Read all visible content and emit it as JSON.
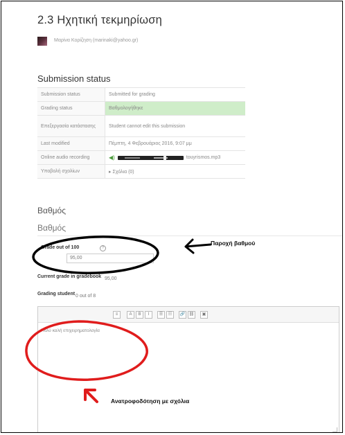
{
  "page": {
    "title": "2.3 Ηχητική τεκμηρίωση"
  },
  "author": {
    "line": "Μαρίνα Κορίζηση (marinaki@yahoo.gr)"
  },
  "submission": {
    "heading": "Submission status",
    "rows": [
      {
        "key": "Submission status",
        "value": "Submitted for grading"
      },
      {
        "key": "Grading status",
        "value": "Βαθμολογήθηκε"
      },
      {
        "key": "Επεξεργασία κατάστασης",
        "value": "Student cannot edit this submission"
      },
      {
        "key": "Last modified",
        "value": "Πέμπτη, 4 Φεβρουάριος 2016, 9:07 μμ"
      },
      {
        "key": "Online audio recording",
        "value": "touyrismos.mp3"
      },
      {
        "key": "Υποβολή σχολίων",
        "value": "▸ Σχόλια (0)"
      }
    ],
    "highlight_color": "#cfedc9"
  },
  "grade": {
    "heading_1": "Βαθμός",
    "heading_2": "Βαθμός",
    "grade_label": "Grade out of 100",
    "grade_value": "95,00",
    "current_label": "Current grade in gradebook",
    "current_value": "95,00",
    "grading_student_label": "Grading student",
    "grading_student_value": "0 out of 8"
  },
  "editor": {
    "toolbar": [
      "≡",
      "A",
      "B",
      "I",
      "☰",
      "☷",
      "🔗",
      "⛓",
      "▣"
    ],
    "text": "Πολύ καλή επιχειρηματολογία"
  },
  "annotations": {
    "grade_note": "Παροχή βαθμού",
    "feedback_note": "Ανατροφοδότηση με σχόλια",
    "black_color": "#000000",
    "red_color": "#e01c1c"
  }
}
